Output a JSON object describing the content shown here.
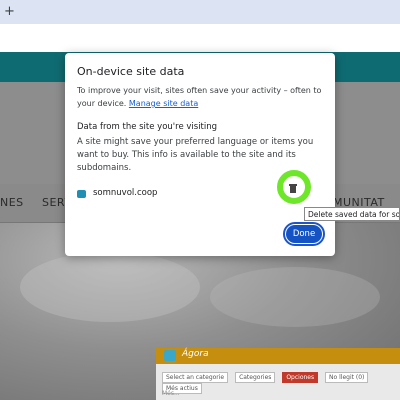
{
  "browser": {
    "new_tab_label": "+"
  },
  "site_nav": {
    "items": [
      "NES",
      "SERV",
      "MUNITAT"
    ]
  },
  "background_preview": {
    "app_title": "Ágora",
    "filter_select": "Select an categorie",
    "chips": [
      "Categories",
      "Opciones",
      "No llegit (0)",
      "Més actius"
    ],
    "footer": "Més..."
  },
  "dialog": {
    "title": "On-device site data",
    "intro": "To improve your visit, sites often save your activity – often to your device.",
    "manage_link": "Manage site data",
    "subheading": "Data from the site you're visiting",
    "description": "A site might save your preferred language or items you want to buy. This info is available to the site and its subdomains.",
    "site": {
      "name": "somnuvol.coop",
      "icon": "site-favicon"
    },
    "delete_icon": "trash-icon",
    "tooltip": "Delete saved data for somnuvol.coop",
    "done_label": "Done"
  },
  "colors": {
    "accent": "#1453c4",
    "highlight_ring": "#6ee62a",
    "site_teal": "#0f6b72"
  }
}
